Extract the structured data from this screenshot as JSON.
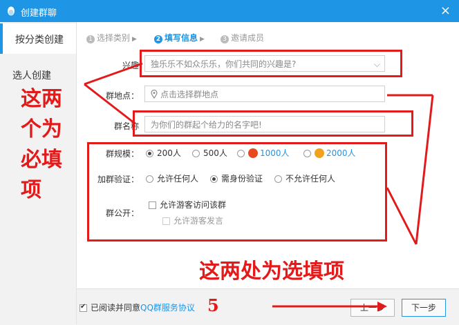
{
  "window": {
    "title": "创建群聊",
    "close_glyph": "×"
  },
  "sidebar": {
    "items": [
      {
        "label": "按分类创建"
      },
      {
        "label": "选人创建"
      }
    ]
  },
  "steps": [
    {
      "num": "1",
      "label": "选择类别"
    },
    {
      "num": "2",
      "label": "填写信息"
    },
    {
      "num": "3",
      "label": "邀请成员"
    }
  ],
  "form": {
    "interest_label": "兴趣",
    "interest_placeholder": "独乐乐不如众乐乐，你们共同的兴趣是?",
    "location_label": "群地点：",
    "location_placeholder": "点击选择群地点",
    "name_label": "群名称",
    "name_placeholder": "为你们的群起个给力的名字吧!",
    "size_label": "群规模：",
    "size_options": [
      "200人",
      "500人",
      "1000人",
      "2000人"
    ],
    "verify_label": "加群验证：",
    "verify_options": [
      "允许任何人",
      "需身份验证",
      "不允许任何人"
    ],
    "public_label": "群公开：",
    "public_options": [
      "允许游客访问该群",
      "允许游客发言"
    ]
  },
  "footer": {
    "agree_text": "已阅读并同意",
    "agree_link": "QQ群服务协议",
    "prev_button": "上一步",
    "next_button": "下一步"
  },
  "annotations": {
    "required_text_1": "这两",
    "required_text_2": "个为",
    "required_text_3": "必填",
    "required_text_4": "项",
    "optional_text": "这两处为选填项",
    "step_number": "5"
  },
  "colors": {
    "accent": "#1f95e6",
    "annotation": "#e21a1a"
  }
}
